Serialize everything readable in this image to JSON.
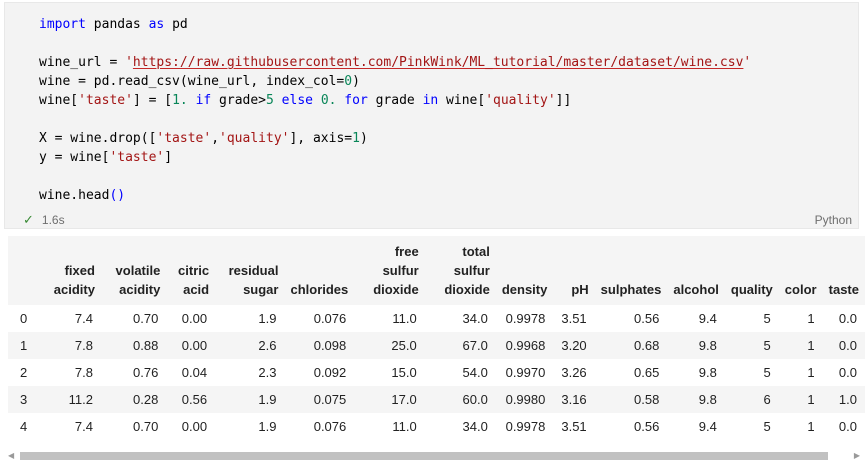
{
  "code_cell": {
    "lines": [
      {
        "parts": [
          {
            "t": "import",
            "c": "kw"
          },
          {
            "t": " pandas "
          },
          {
            "t": "as",
            "c": "kw"
          },
          {
            "t": " pd"
          }
        ]
      },
      {
        "parts": []
      },
      {
        "parts": [
          {
            "t": "wine_url = "
          },
          {
            "t": "'",
            "c": "str"
          },
          {
            "t": "https://raw.githubusercontent.com/PinkWink/ML_tutorial/master/dataset/wine.csv",
            "c": "url"
          },
          {
            "t": "'",
            "c": "str"
          }
        ]
      },
      {
        "parts": [
          {
            "t": "wine = pd.read_csv(wine_url, index_col="
          },
          {
            "t": "0",
            "c": "num"
          },
          {
            "t": ")"
          }
        ]
      },
      {
        "parts": [
          {
            "t": "wine["
          },
          {
            "t": "'taste'",
            "c": "str"
          },
          {
            "t": "] = ["
          },
          {
            "t": "1.",
            "c": "num"
          },
          {
            "t": " "
          },
          {
            "t": "if",
            "c": "kw"
          },
          {
            "t": " grade>"
          },
          {
            "t": "5",
            "c": "num"
          },
          {
            "t": " "
          },
          {
            "t": "else",
            "c": "kw"
          },
          {
            "t": " "
          },
          {
            "t": "0.",
            "c": "num"
          },
          {
            "t": " "
          },
          {
            "t": "for",
            "c": "kw"
          },
          {
            "t": " grade "
          },
          {
            "t": "in",
            "c": "kw"
          },
          {
            "t": " wine["
          },
          {
            "t": "'quality'",
            "c": "str"
          },
          {
            "t": "]]"
          }
        ]
      },
      {
        "parts": []
      },
      {
        "parts": [
          {
            "t": "X = wine.drop(["
          },
          {
            "t": "'taste'",
            "c": "str"
          },
          {
            "t": ","
          },
          {
            "t": "'quality'",
            "c": "str"
          },
          {
            "t": "], axis="
          },
          {
            "t": "1",
            "c": "num"
          },
          {
            "t": ")"
          }
        ]
      },
      {
        "parts": [
          {
            "t": "y = wine["
          },
          {
            "t": "'taste'",
            "c": "str"
          },
          {
            "t": "]"
          }
        ]
      },
      {
        "parts": []
      },
      {
        "parts": [
          {
            "t": "wine.head"
          },
          {
            "t": "()",
            "c": "fn"
          }
        ]
      }
    ],
    "status": {
      "icon": "check-icon",
      "duration": "1.6s"
    },
    "language": "Python"
  },
  "output_table": {
    "headers": [
      "",
      "fixed acidity",
      "volatile acidity",
      "citric acid",
      "residual sugar",
      "chlorides",
      "free sulfur dioxide",
      "total sulfur dioxide",
      "density",
      "pH",
      "sulphates",
      "alcohol",
      "quality",
      "color",
      "taste"
    ],
    "rows": [
      [
        "0",
        "7.4",
        "0.70",
        "0.00",
        "1.9",
        "0.076",
        "11.0",
        "34.0",
        "0.9978",
        "3.51",
        "0.56",
        "9.4",
        "5",
        "1",
        "0.0"
      ],
      [
        "1",
        "7.8",
        "0.88",
        "0.00",
        "2.6",
        "0.098",
        "25.0",
        "67.0",
        "0.9968",
        "3.20",
        "0.68",
        "9.8",
        "5",
        "1",
        "0.0"
      ],
      [
        "2",
        "7.8",
        "0.76",
        "0.04",
        "2.3",
        "0.092",
        "15.0",
        "54.0",
        "0.9970",
        "3.26",
        "0.65",
        "9.8",
        "5",
        "1",
        "0.0"
      ],
      [
        "3",
        "11.2",
        "0.28",
        "0.56",
        "1.9",
        "0.075",
        "17.0",
        "60.0",
        "0.9980",
        "3.16",
        "0.58",
        "9.8",
        "6",
        "1",
        "1.0"
      ],
      [
        "4",
        "7.4",
        "0.70",
        "0.00",
        "1.9",
        "0.076",
        "11.0",
        "34.0",
        "0.9978",
        "3.51",
        "0.56",
        "9.4",
        "5",
        "1",
        "0.0"
      ]
    ]
  },
  "scrollbar": {
    "left_icon": "scroll-left-arrow-icon",
    "right_icon": "scroll-right-arrow-icon"
  },
  "colors": {
    "keyword": "#0000ff",
    "string": "#a31515",
    "number": "#098658",
    "success": "#388a34",
    "cell_background": "#f3f3f3"
  }
}
